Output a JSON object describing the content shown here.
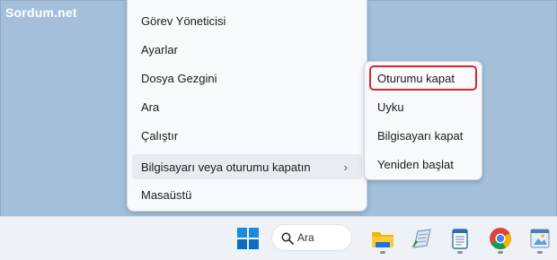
{
  "watermark": "Sordum.net",
  "context_menu": {
    "items": [
      {
        "label": "Görev Yöneticisi"
      },
      {
        "label": "Ayarlar"
      },
      {
        "label": "Dosya Gezgini"
      },
      {
        "label": "Ara"
      },
      {
        "label": "Çalıştır"
      },
      {
        "label": "Bilgisayarı veya oturumu kapatın",
        "has_submenu": true,
        "active": true
      },
      {
        "label": "Masaüstü"
      }
    ]
  },
  "submenu": {
    "items": [
      {
        "label": "Oturumu kapat",
        "highlighted": true
      },
      {
        "label": "Uyku"
      },
      {
        "label": "Bilgisayarı kapat"
      },
      {
        "label": "Yeniden başlat"
      }
    ]
  },
  "taskbar": {
    "search_label": "Ara",
    "icons": [
      "windows-start-icon",
      "search-icon",
      "file-explorer-icon",
      "notepad-pencil-icon",
      "notepad-icon",
      "chrome-icon",
      "image-viewer-icon"
    ]
  },
  "colors": {
    "desktop": "#a3bfd9",
    "highlight_border": "#d9262c",
    "windows_blue": "#0a78d4"
  }
}
